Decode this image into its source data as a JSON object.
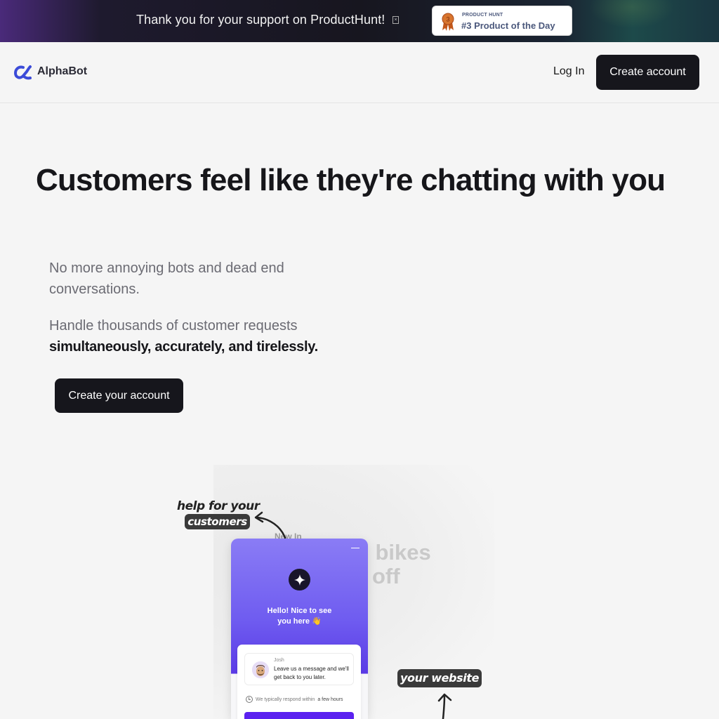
{
  "banner": {
    "text": "Thank you for your support on ProductHunt!",
    "close_glyph": "×",
    "badge": {
      "small": "PRODUCT HUNT",
      "big": "#3 Product of the Day",
      "medal_number": "3"
    }
  },
  "header": {
    "logo_text": "AlphaBot",
    "login": "Log In",
    "create_account": "Create account"
  },
  "hero": {
    "title": "Customers feel like they're chatting with you",
    "p1": "No more annoying bots and dead end conversations.",
    "p2_normal": "Handle thousands of customer requests",
    "p2_bold": "simultaneously, accurately, and tirelessly.",
    "cta": "Create your account"
  },
  "illustration": {
    "note_help": "help for your",
    "note_customers": "customers",
    "note_website": "your website",
    "site_new_in": "New In",
    "site_line1": "el bikes",
    "site_line2": "off",
    "widget": {
      "greeting_line1": "Hello! Nice to see",
      "greeting_line2": "you here 👋",
      "agent_name": "Josh",
      "message": "Leave us a message and we'll get back to you later.",
      "response_prefix": "We typically respond within",
      "response_time": "a few hours"
    }
  },
  "colors": {
    "accent": "#5b21f0",
    "dark_button": "#16161c",
    "logo_blue": "#3b4bd8"
  }
}
